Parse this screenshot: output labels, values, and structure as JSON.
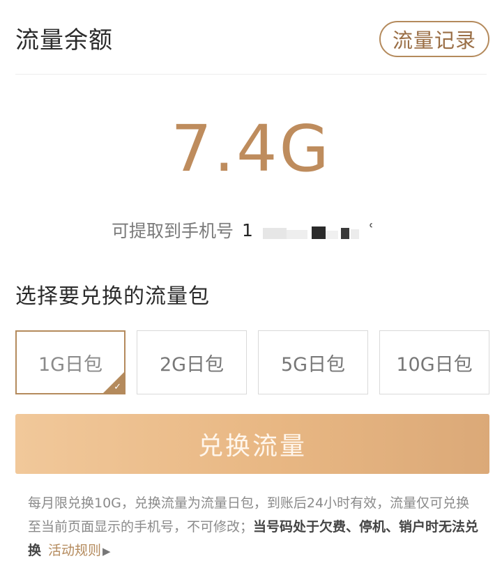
{
  "header": {
    "title": "流量余额",
    "record_button": "流量记录"
  },
  "balance": {
    "value": "7.4G"
  },
  "phone": {
    "label": "可提取到手机号",
    "number_visible": "1",
    "number_tail": "ʿ"
  },
  "packages": {
    "title": "选择要兑换的流量包",
    "items": [
      {
        "label": "1G日包",
        "selected": true
      },
      {
        "label": "2G日包",
        "selected": false
      },
      {
        "label": "5G日包",
        "selected": false
      },
      {
        "label": "10G日包",
        "selected": false
      }
    ],
    "check_icon": "✓"
  },
  "exchange_button": "兑换流量",
  "notice": {
    "text_normal": "每月限兑换10G，兑换流量为流量日包，到账后24小时有效，流量仅可兑换至当前页面显示的手机号，不可修改；",
    "text_strong": "当号码处于欠费、停机、销户时无法兑换",
    "rules_link": "活动规则",
    "rules_arrow": "▶"
  },
  "colors": {
    "accent": "#b48a5c",
    "balance": "#be8c5d",
    "button_gradient_start": "#f1c89a",
    "button_gradient_end": "#dba978"
  }
}
